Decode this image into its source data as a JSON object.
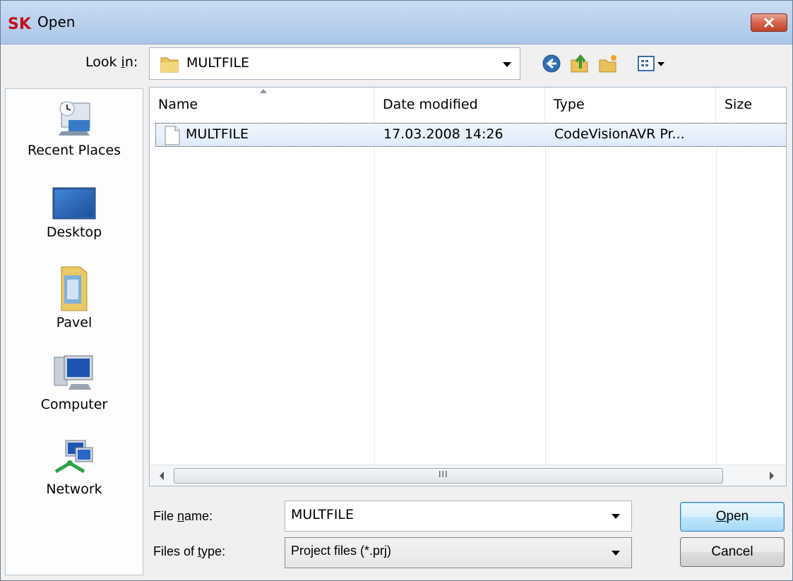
{
  "window": {
    "title": "Open",
    "app_icon_text": "SK"
  },
  "lookin": {
    "label_prefix": "Look ",
    "label_mnemonic": "i",
    "label_suffix": "n:",
    "value": "MULTFILE"
  },
  "places": [
    {
      "label": "Recent Places",
      "icon": "recent-places-icon"
    },
    {
      "label": "Desktop",
      "icon": "desktop-icon"
    },
    {
      "label": "Pavel",
      "icon": "user-folder-icon"
    },
    {
      "label": "Computer",
      "icon": "computer-icon"
    },
    {
      "label": "Network",
      "icon": "network-icon"
    }
  ],
  "columns": [
    {
      "label": "Name",
      "sorted": "ascending"
    },
    {
      "label": "Date modified"
    },
    {
      "label": "Type"
    },
    {
      "label": "Size"
    }
  ],
  "files": [
    {
      "name": "MULTFILE",
      "date_modified": "17.03.2008 14:26",
      "type": "CodeVisionAVR Pr...",
      "size": "",
      "selected": true
    }
  ],
  "scrollbar": {
    "grip": "III"
  },
  "filename": {
    "label_prefix": "File ",
    "label_mnemonic": "n",
    "label_suffix": "ame:",
    "value": "MULTFILE"
  },
  "filetype": {
    "label_prefix": "Files of ",
    "label_mnemonic": "t",
    "label_suffix": "ype:",
    "value": "Project files (*.prj)"
  },
  "buttons": {
    "open_mnemonic": "O",
    "open_rest": "pen",
    "cancel": "Cancel"
  },
  "colors": {
    "titlebar": "#bcd3ee",
    "close": "#c2432c",
    "selection": "#dfebfb"
  }
}
